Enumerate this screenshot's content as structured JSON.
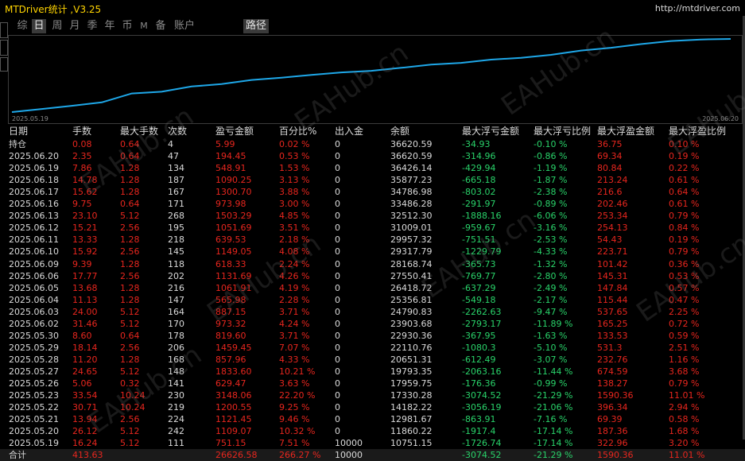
{
  "window": {
    "title": "MTDriver统计 ,V3.25",
    "url": "http://mtdriver.com"
  },
  "tabs": [
    {
      "label": "综",
      "active": false
    },
    {
      "label": "日",
      "active": true
    },
    {
      "label": "周",
      "active": false
    },
    {
      "label": "月",
      "active": false
    },
    {
      "label": "季",
      "active": false
    },
    {
      "label": "年",
      "active": false
    },
    {
      "label": "币",
      "active": false
    },
    {
      "label": "M",
      "active": false
    },
    {
      "label": "备",
      "active": false
    },
    {
      "label": "账户",
      "active": false
    },
    {
      "label": "路径",
      "active": true
    }
  ],
  "chart_data": {
    "type": "line",
    "x_start_label": "2025.05.19",
    "x_end_label": "2025.06.20",
    "series": [
      {
        "values": [
          10751.15,
          11860.22,
          12981.67,
          14182.22,
          17330.28,
          17959.75,
          19793.35,
          20651.31,
          22110.76,
          22930.36,
          23903.68,
          24790.83,
          25356.81,
          26418.72,
          27550.41,
          28168.74,
          29317.79,
          29957.32,
          31009.01,
          32512.3,
          33486.28,
          34786.98,
          35877.23,
          36426.14,
          36620.59
        ]
      }
    ],
    "color": "#1ea7e8",
    "grid": false
  },
  "table": {
    "headers": [
      "日期",
      "手数",
      "最大手数",
      "次数",
      "盈亏金额",
      "百分比%",
      "出入金",
      "余额",
      "最大浮亏金额",
      "最大浮亏比例",
      "最大浮盈金额",
      "最大浮盈比例"
    ],
    "rows": [
      [
        "持仓",
        "0.08",
        "0.64",
        "4",
        "5.99",
        "0.02 %",
        "0",
        "36620.59",
        "-34.93",
        "-0.10 %",
        "36.75",
        "0.10 %"
      ],
      [
        "2025.06.20",
        "2.35",
        "0.64",
        "47",
        "194.45",
        "0.53 %",
        "0",
        "36620.59",
        "-314.96",
        "-0.86 %",
        "69.34",
        "0.19 %"
      ],
      [
        "2025.06.19",
        "7.86",
        "1.28",
        "134",
        "548.91",
        "1.53 %",
        "0",
        "36426.14",
        "-429.94",
        "-1.19 %",
        "80.84",
        "0.22 %"
      ],
      [
        "2025.06.18",
        "14.78",
        "1.28",
        "187",
        "1090.25",
        "3.13 %",
        "0",
        "35877.23",
        "-665.18",
        "-1.87 %",
        "213.24",
        "0.61 %"
      ],
      [
        "2025.06.17",
        "15.62",
        "1.28",
        "167",
        "1300.70",
        "3.88 %",
        "0",
        "34786.98",
        "-803.02",
        "-2.38 %",
        "216.6",
        "0.64 %"
      ],
      [
        "2025.06.16",
        "9.75",
        "0.64",
        "171",
        "973.98",
        "3.00 %",
        "0",
        "33486.28",
        "-291.97",
        "-0.89 %",
        "202.46",
        "0.61 %"
      ],
      [
        "2025.06.13",
        "23.10",
        "5.12",
        "268",
        "1503.29",
        "4.85 %",
        "0",
        "32512.30",
        "-1888.16",
        "-6.06 %",
        "253.34",
        "0.79 %"
      ],
      [
        "2025.06.12",
        "15.21",
        "2.56",
        "195",
        "1051.69",
        "3.51 %",
        "0",
        "31009.01",
        "-959.67",
        "-3.16 %",
        "254.13",
        "0.84 %"
      ],
      [
        "2025.06.11",
        "13.33",
        "1.28",
        "218",
        "639.53",
        "2.18 %",
        "0",
        "29957.32",
        "-751.51",
        "-2.53 %",
        "54.43",
        "0.19 %"
      ],
      [
        "2025.06.10",
        "15.92",
        "2.56",
        "145",
        "1149.05",
        "4.08 %",
        "0",
        "29317.79",
        "-1229.79",
        "-4.33 %",
        "223.71",
        "0.79 %"
      ],
      [
        "2025.06.09",
        "9.39",
        "1.28",
        "118",
        "618.33",
        "2.24 %",
        "0",
        "28168.74",
        "-365.73",
        "-1.32 %",
        "101.42",
        "0.36 %"
      ],
      [
        "2025.06.06",
        "17.77",
        "2.56",
        "202",
        "1131.69",
        "4.26 %",
        "0",
        "27550.41",
        "-769.77",
        "-2.80 %",
        "145.31",
        "0.53 %"
      ],
      [
        "2025.06.05",
        "13.68",
        "1.28",
        "216",
        "1061.91",
        "4.19 %",
        "0",
        "26418.72",
        "-637.29",
        "-2.49 %",
        "147.84",
        "0.57 %"
      ],
      [
        "2025.06.04",
        "11.13",
        "1.28",
        "147",
        "565.98",
        "2.28 %",
        "0",
        "25356.81",
        "-549.18",
        "-2.17 %",
        "115.44",
        "0.47 %"
      ],
      [
        "2025.06.03",
        "24.00",
        "5.12",
        "164",
        "887.15",
        "3.71 %",
        "0",
        "24790.83",
        "-2262.63",
        "-9.47 %",
        "537.65",
        "2.25 %"
      ],
      [
        "2025.06.02",
        "31.46",
        "5.12",
        "170",
        "973.32",
        "4.24 %",
        "0",
        "23903.68",
        "-2793.17",
        "-11.89 %",
        "165.25",
        "0.72 %"
      ],
      [
        "2025.05.30",
        "8.60",
        "0.64",
        "178",
        "819.60",
        "3.71 %",
        "0",
        "22930.36",
        "-367.95",
        "-1.63 %",
        "133.53",
        "0.59 %"
      ],
      [
        "2025.05.29",
        "18.14",
        "2.56",
        "206",
        "1459.45",
        "7.07 %",
        "0",
        "22110.76",
        "-1080.3",
        "-5.10 %",
        "531.3",
        "2.51 %"
      ],
      [
        "2025.05.28",
        "11.20",
        "1.28",
        "168",
        "857.96",
        "4.33 %",
        "0",
        "20651.31",
        "-612.49",
        "-3.07 %",
        "232.76",
        "1.16 %"
      ],
      [
        "2025.05.27",
        "24.65",
        "5.12",
        "148",
        "1833.60",
        "10.21 %",
        "0",
        "19793.35",
        "-2063.16",
        "-11.44 %",
        "674.59",
        "3.68 %"
      ],
      [
        "2025.05.26",
        "5.06",
        "0.32",
        "141",
        "629.47",
        "3.63 %",
        "0",
        "17959.75",
        "-176.36",
        "-0.99 %",
        "138.27",
        "0.79 %"
      ],
      [
        "2025.05.23",
        "33.54",
        "10.24",
        "230",
        "3148.06",
        "22.20 %",
        "0",
        "17330.28",
        "-3074.52",
        "-21.29 %",
        "1590.36",
        "11.01 %"
      ],
      [
        "2025.05.22",
        "30.71",
        "10.24",
        "219",
        "1200.55",
        "9.25 %",
        "0",
        "14182.22",
        "-3056.19",
        "-21.06 %",
        "396.34",
        "2.94 %"
      ],
      [
        "2025.05.21",
        "13.94",
        "2.56",
        "224",
        "1121.45",
        "9.46 %",
        "0",
        "12981.67",
        "-863.91",
        "-7.16 %",
        "69.39",
        "0.58 %"
      ],
      [
        "2025.05.20",
        "26.12",
        "5.12",
        "242",
        "1109.07",
        "10.32 %",
        "0",
        "11860.22",
        "-1917.4",
        "-17.14 %",
        "187.36",
        "1.68 %"
      ],
      [
        "2025.05.19",
        "16.24",
        "5.12",
        "111",
        "751.15",
        "7.51 %",
        "10000",
        "10751.15",
        "-1726.74",
        "-17.14 %",
        "322.96",
        "3.20 %"
      ]
    ],
    "total": [
      "合计",
      "413.63",
      "",
      "",
      "26626.58",
      "266.27 %",
      "10000",
      "",
      "-3074.52",
      "-21.29 %",
      "1590.36",
      "11.01 %"
    ]
  },
  "colors": {
    "title": "#ffd400",
    "positive": "#e8261e",
    "negative": "#29d36a",
    "line": "#1ea7e8"
  },
  "watermark_text": "EAHub.cn"
}
